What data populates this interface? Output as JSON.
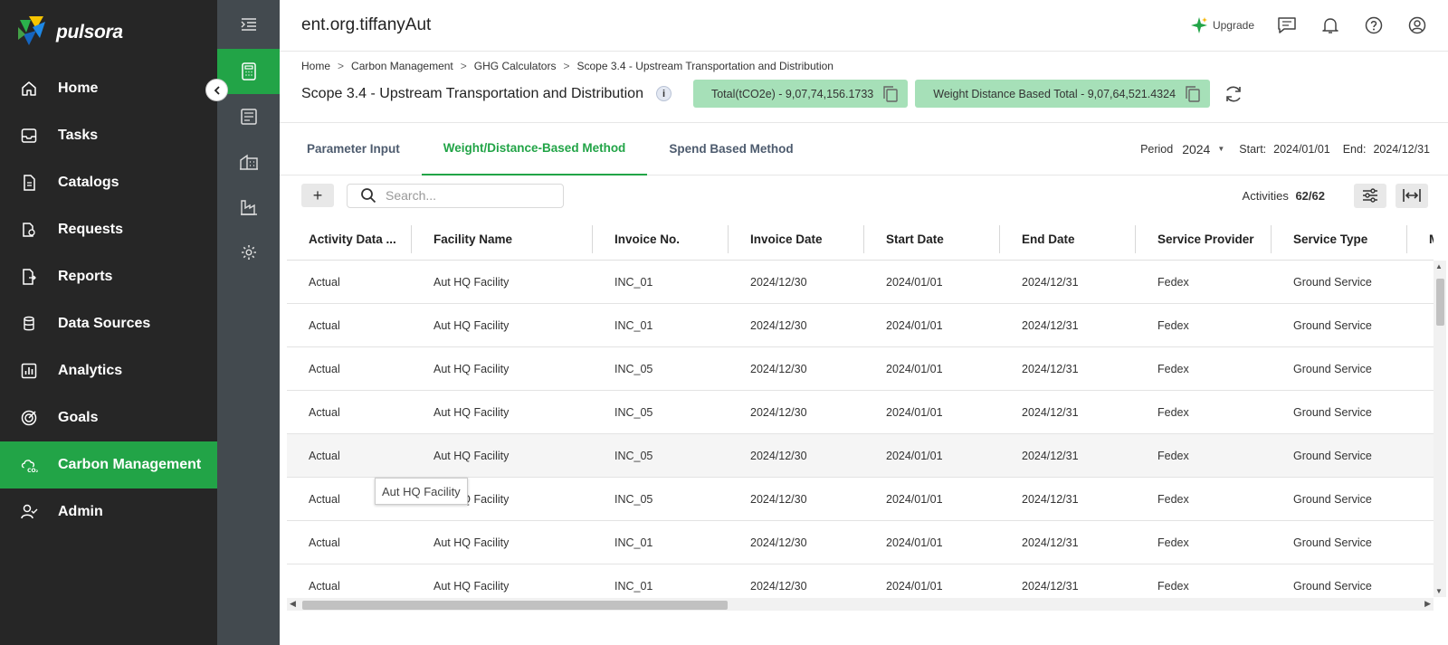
{
  "brand": {
    "name": "pulsora"
  },
  "nav": {
    "items": [
      {
        "label": "Home",
        "icon": "home-icon"
      },
      {
        "label": "Tasks",
        "icon": "inbox-icon"
      },
      {
        "label": "Catalogs",
        "icon": "document-icon"
      },
      {
        "label": "Requests",
        "icon": "requests-icon"
      },
      {
        "label": "Reports",
        "icon": "reports-icon"
      },
      {
        "label": "Data Sources",
        "icon": "database-icon"
      },
      {
        "label": "Analytics",
        "icon": "bar-chart-icon"
      },
      {
        "label": "Goals",
        "icon": "target-icon"
      },
      {
        "label": "Carbon Management",
        "icon": "co2-cloud-icon",
        "active": true
      },
      {
        "label": "Admin",
        "icon": "user-check-icon"
      }
    ]
  },
  "topbar": {
    "org_title": "ent.org.tiffanyAut",
    "upgrade_label": "Upgrade"
  },
  "breadcrumb": {
    "items": [
      "Home",
      "Carbon Management",
      "GHG Calculators",
      "Scope 3.4 - Upstream Transportation and Distribution"
    ]
  },
  "page": {
    "title": "Scope 3.4 - Upstream Transportation and Distribution",
    "info_glyph": "i",
    "total_pill": "Total(tCO2e) - 9,07,74,156.1733",
    "weight_pill": "Weight Distance Based Total - 9,07,64,521.4324"
  },
  "tabs": [
    {
      "label": "Parameter Input"
    },
    {
      "label": "Weight/Distance-Based Method",
      "active": true
    },
    {
      "label": "Spend Based Method"
    }
  ],
  "period": {
    "label": "Period",
    "year": "2024",
    "start_label": "Start:",
    "start_value": "2024/01/01",
    "end_label": "End:",
    "end_value": "2024/12/31"
  },
  "toolbar": {
    "add_label": "+",
    "search_placeholder": "Search...",
    "activities_label": "Activities",
    "activities_count": "62/62"
  },
  "table": {
    "columns": [
      "Activity Data ...",
      "Facility Name",
      "Invoice No.",
      "Invoice Date",
      "Start Date",
      "End Date",
      "Service Provider",
      "Service Type",
      "M"
    ],
    "rows": [
      [
        "Actual",
        "Aut HQ Facility",
        "INC_01",
        "2024/12/30",
        "2024/01/01",
        "2024/12/31",
        "Fedex",
        "Ground Service"
      ],
      [
        "Actual",
        "Aut HQ Facility",
        "INC_01",
        "2024/12/30",
        "2024/01/01",
        "2024/12/31",
        "Fedex",
        "Ground Service"
      ],
      [
        "Actual",
        "Aut HQ Facility",
        "INC_05",
        "2024/12/30",
        "2024/01/01",
        "2024/12/31",
        "Fedex",
        "Ground Service"
      ],
      [
        "Actual",
        "Aut HQ Facility",
        "INC_05",
        "2024/12/30",
        "2024/01/01",
        "2024/12/31",
        "Fedex",
        "Ground Service"
      ],
      [
        "Actual",
        "Aut HQ Facility",
        "INC_05",
        "2024/12/30",
        "2024/01/01",
        "2024/12/31",
        "Fedex",
        "Ground Service"
      ],
      [
        "Actual",
        "Aut HQ Facility",
        "INC_05",
        "2024/12/30",
        "2024/01/01",
        "2024/12/31",
        "Fedex",
        "Ground Service"
      ],
      [
        "Actual",
        "Aut HQ Facility",
        "INC_01",
        "2024/12/30",
        "2024/01/01",
        "2024/12/31",
        "Fedex",
        "Ground Service"
      ],
      [
        "Actual",
        "Aut HQ Facility",
        "INC_01",
        "2024/12/30",
        "2024/01/01",
        "2024/12/31",
        "Fedex",
        "Ground Service"
      ]
    ],
    "highlighted_row": 4
  },
  "tooltip": {
    "text": "Aut HQ Facility"
  },
  "colors": {
    "accent": "#22a447",
    "nav_bg": "#262626",
    "rail_bg": "#434a4f",
    "pill_bg": "#a6e0b8"
  }
}
